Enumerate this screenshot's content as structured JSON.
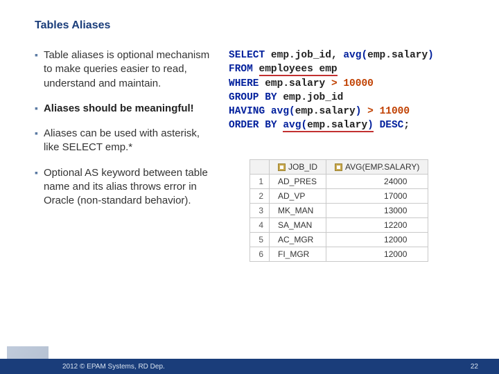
{
  "title": "Tables Aliases",
  "bullets": [
    {
      "text": "Table aliases is optional mechanism to make queries easier to read, understand and maintain.",
      "bold": false
    },
    {
      "text": "Aliases should be meaningful!",
      "bold": true
    },
    {
      "text": "Aliases can be used with asterisk, like SELECT emp.*",
      "bold": false
    },
    {
      "text": "Optional AS keyword between table name and its alias throws error in Oracle (non-standard behavior).",
      "bold": false
    }
  ],
  "code": {
    "select": "SELECT",
    "emp_job_id": "emp.job_id",
    "comma": ", ",
    "avg_fn": "avg",
    "lp": "(",
    "emp_salary": "emp.salary",
    "rp": ")",
    "from": "FROM",
    "employees_emp": "employees emp",
    "where": "WHERE",
    "gt": ">",
    "val1": "10000",
    "group_by": "GROUP BY",
    "having": "HAVING",
    "val2": "11000",
    "order_by": "ORDER BY",
    "desc": "DESC",
    "semi": ";"
  },
  "table": {
    "headers": [
      "JOB_ID",
      "AVG(EMP.SALARY)"
    ],
    "rows": [
      {
        "n": "1",
        "job": "AD_PRES",
        "avg": "24000"
      },
      {
        "n": "2",
        "job": "AD_VP",
        "avg": "17000"
      },
      {
        "n": "3",
        "job": "MK_MAN",
        "avg": "13000"
      },
      {
        "n": "4",
        "job": "SA_MAN",
        "avg": "12200"
      },
      {
        "n": "5",
        "job": "AC_MGR",
        "avg": "12000"
      },
      {
        "n": "6",
        "job": "FI_MGR",
        "avg": "12000"
      }
    ]
  },
  "footer": {
    "copyright": "2012 © EPAM Systems, RD Dep.",
    "page": "22"
  }
}
